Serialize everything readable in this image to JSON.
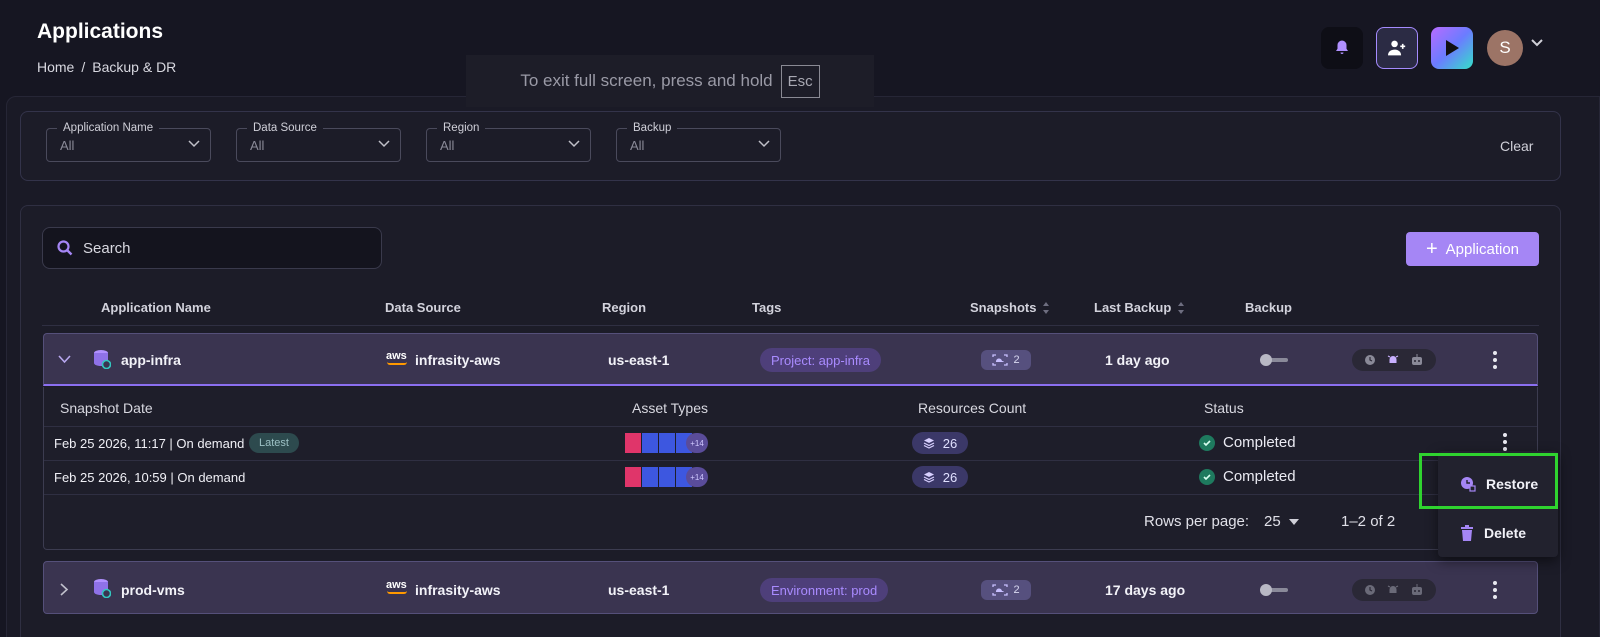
{
  "header": {
    "title": "Applications",
    "breadcrumb": [
      "Home",
      "/",
      "Backup & DR"
    ],
    "fullscreen_notice": "To exit full screen, press and hold",
    "fullscreen_key": "Esc",
    "avatar_initial": "S",
    "icons": [
      "bell-icon",
      "user-plus-icon",
      "play-icon",
      "chevron-down-icon"
    ]
  },
  "filters": [
    {
      "label": "Application Name",
      "value": "All"
    },
    {
      "label": "Data Source",
      "value": "All"
    },
    {
      "label": "Region",
      "value": "All"
    },
    {
      "label": "Backup",
      "value": "All"
    }
  ],
  "clear_label": "Clear",
  "search_placeholder": "Search",
  "add_button_label": "Application",
  "columns": [
    "Application Name",
    "Data Source",
    "Region",
    "Tags",
    "Snapshots",
    "Last Backup",
    "Backup"
  ],
  "apps": [
    {
      "name": "app-infra",
      "source_logo": "aws",
      "source": "infrasity-aws",
      "region": "us-east-1",
      "tag": "Project: app-infra",
      "snapshots": "2",
      "last_backup": "1 day ago",
      "expanded": true
    },
    {
      "name": "prod-vms",
      "source_logo": "aws",
      "source": "infrasity-aws",
      "region": "us-east-1",
      "tag": "Environment: prod",
      "snapshots": "2",
      "last_backup": "17 days ago",
      "expanded": false
    }
  ],
  "details": {
    "columns": [
      "Snapshot Date",
      "Asset Types",
      "Resources Count",
      "Status"
    ],
    "rows": [
      {
        "date": "Feb 25 2026, 11:17 | On demand",
        "badge": "Latest",
        "asset_more": "+14",
        "resources": "26",
        "status": "Completed"
      },
      {
        "date": "Feb 25 2026, 10:59 | On demand",
        "badge": "",
        "asset_more": "+14",
        "resources": "26",
        "status": "Completed"
      }
    ],
    "rows_per_page_label": "Rows per page:",
    "rows_per_page": "25",
    "range": "1–2 of 2"
  },
  "menu": {
    "restore": "Restore",
    "delete": "Delete"
  },
  "colors": {
    "accent": "#a586f5",
    "highlight": "#2fd32f",
    "status_ok": "#1e7a5e"
  }
}
